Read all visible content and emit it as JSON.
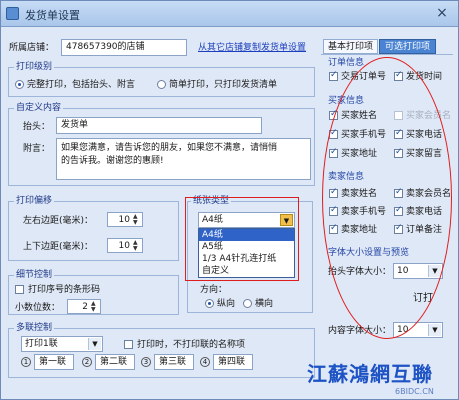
{
  "window": {
    "title": "发货单设置"
  },
  "header": {
    "shop_label": "所属店铺：",
    "shop_value": "478657390的店铺",
    "copy_link": "从其它店铺复制发货单设置"
  },
  "print_level": {
    "title": "打印级别",
    "options": [
      {
        "label": "完整打印，包括抬头、附言",
        "selected": true
      },
      {
        "label": "简单打印，只打印发货清单",
        "selected": false
      }
    ]
  },
  "custom_content": {
    "title": "自定义内容",
    "header_label": "抬头：",
    "header_value": "发货单",
    "note_label": "附言：",
    "note_line1": "如果您满意，请告诉您的朋友，如果您不满意，请悄悄",
    "note_line2": "的告诉我。谢谢您的惠顾!"
  },
  "print_offset": {
    "title": "打印偏移",
    "left_label": "左右边距(毫米)：",
    "left_value": "10",
    "top_label": "上下边距(毫米)：",
    "top_value": "10"
  },
  "paper_type": {
    "title": "纸张类型",
    "selected": "A4纸",
    "options": [
      "A4纸",
      "A5纸",
      "1/3 A4针孔连打纸",
      "自定义"
    ],
    "highlighted_index": 0,
    "direction_label": "方向：",
    "direction_options": [
      {
        "label": "纵向",
        "selected": true
      },
      {
        "label": "横向",
        "selected": false
      }
    ]
  },
  "detail_control": {
    "title": "细节控制",
    "barcode_label": "打印序号的条形码",
    "barcode_checked": false,
    "decimal_label": "小数位数：",
    "decimal_value": "2"
  },
  "multi_copy": {
    "title": "多联控制",
    "copies_selected": "打印1联",
    "skip_names_label": "打印时，不打印联的名称项",
    "skip_names_checked": false,
    "slots": [
      {
        "number": "1",
        "value": "第一联"
      },
      {
        "number": "2",
        "value": "第二联"
      },
      {
        "number": "3",
        "value": "第三联"
      },
      {
        "number": "4",
        "value": "第四联"
      }
    ]
  },
  "tabs": [
    {
      "label": "基本打印项",
      "active": true
    },
    {
      "label": "可选打印项",
      "active": false
    }
  ],
  "order_info": {
    "title": "订单信息",
    "items": [
      {
        "label": "交易订单号",
        "checked": true,
        "dim": false
      },
      {
        "label": "发货时间",
        "checked": true,
        "dim": false
      }
    ]
  },
  "buyer_info": {
    "title": "买家信息",
    "items": [
      {
        "label": "买家姓名",
        "checked": true,
        "dim": false
      },
      {
        "label": "买家会员名",
        "checked": false,
        "dim": true
      },
      {
        "label": "买家手机号",
        "checked": true,
        "dim": false
      },
      {
        "label": "买家电话",
        "checked": true,
        "dim": false
      },
      {
        "label": "买家地址",
        "checked": true,
        "dim": false
      },
      {
        "label": "买家留言",
        "checked": true,
        "dim": false
      }
    ]
  },
  "seller_info": {
    "title": "卖家信息",
    "items": [
      {
        "label": "卖家姓名",
        "checked": true,
        "dim": false
      },
      {
        "label": "卖家会员名",
        "checked": true,
        "dim": false
      },
      {
        "label": "卖家手机号",
        "checked": true,
        "dim": false
      },
      {
        "label": "卖家电话",
        "checked": true,
        "dim": false
      },
      {
        "label": "卖家地址",
        "checked": true,
        "dim": false
      },
      {
        "label": "订单备注",
        "checked": true,
        "dim": false
      }
    ]
  },
  "font_size": {
    "title": "字体大小设置与预览",
    "header_size_label": "抬头字体大小：",
    "header_size_value": "10",
    "preview_text": "订打",
    "content_size_label": "内容字体大小：",
    "content_size_value": "10"
  },
  "watermark": {
    "text": "江蘇鴻網互聯",
    "sub": "6BIDC.CN"
  }
}
